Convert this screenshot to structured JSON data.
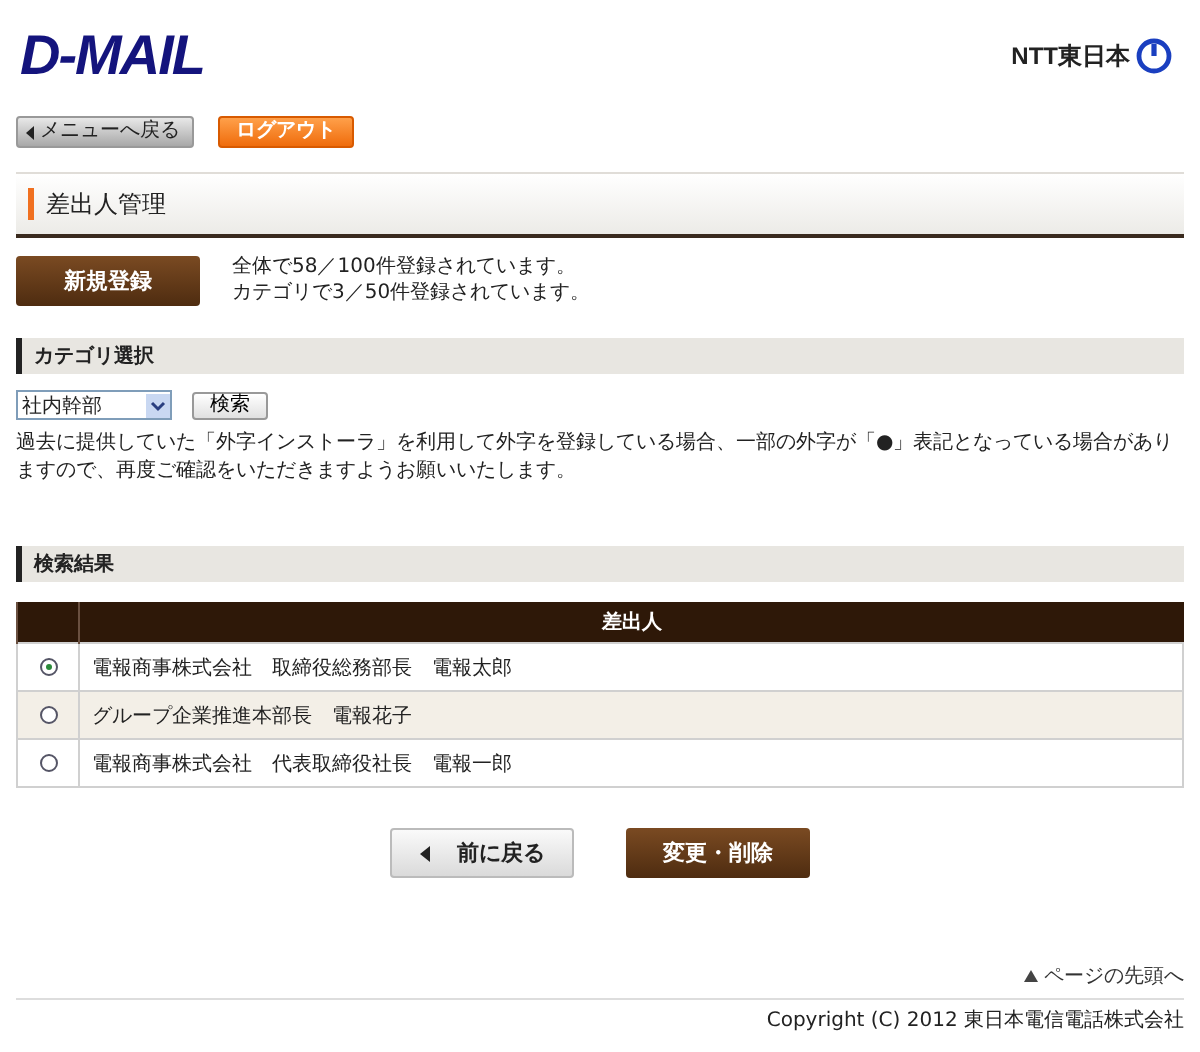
{
  "header": {
    "logo": "D-MAIL",
    "brand": "NTT東日本"
  },
  "nav": [
    {
      "label": "メニューへ戻る",
      "kind": "back"
    },
    {
      "label": "ログアウト",
      "kind": "logout"
    }
  ],
  "page_title": "差出人管理",
  "register_button": "新規登録",
  "counts": [
    "全体で58／100件登録されています。",
    "カテゴリで3／50件登録されています。"
  ],
  "category": {
    "heading": "カテゴリ選択",
    "select_value": "社内幹部",
    "search_button": "検索"
  },
  "notice": "過去に提供していた「外字インストーラ」を利用して外字を登録している場合、一部の外字が「●」表記となっている場合がありますので、再度ご確認をいただきますようお願いいたします。",
  "results": {
    "heading": "検索結果",
    "column": "差出人",
    "rows": [
      {
        "sender": "電報商事株式会社　取締役総務部長　電報太郎",
        "selected": true
      },
      {
        "sender": "グループ企業推進本部長　電報花子",
        "selected": false
      },
      {
        "sender": "電報商事株式会社　代表取締役社長　電報一郎",
        "selected": false
      }
    ]
  },
  "buttons": [
    {
      "label": "前に戻る",
      "kind": "back"
    },
    {
      "label": "変更・削除",
      "kind": "primary"
    }
  ],
  "footer": {
    "page_top": "ページの先頭へ",
    "copyright": "Copyright (C) 2012 東日本電信電話株式会社"
  }
}
